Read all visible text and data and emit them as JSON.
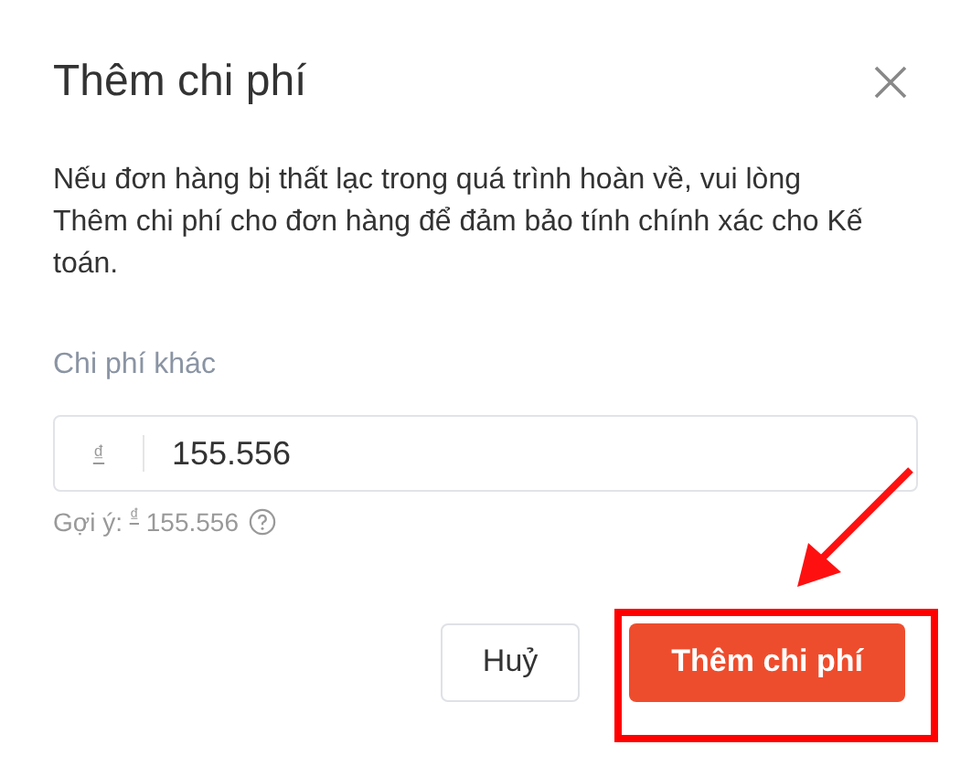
{
  "dialog": {
    "title": "Thêm chi phí",
    "description": "Nếu đơn hàng bị thất lạc trong quá trình hoàn về, vui lòng Thêm chi phí cho đơn hàng để đảm bảo tính chính xác cho Kế toán.",
    "field": {
      "label": "Chi phí khác",
      "currency": "₫",
      "value": "155.556",
      "hint_label": "Gợi ý:",
      "hint_currency": "₫",
      "hint_value": "155.556"
    },
    "buttons": [
      {
        "label": "Huỷ",
        "kind": "secondary"
      },
      {
        "label": "Thêm chi phí",
        "kind": "primary"
      }
    ]
  }
}
